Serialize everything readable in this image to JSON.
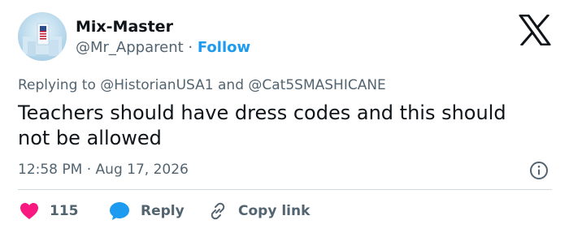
{
  "user": {
    "display_name": "Mix-Master",
    "handle": "@Mr_Apparent",
    "separator": " · ",
    "follow_label": "Follow"
  },
  "reply_context": {
    "prefix": "Replying to ",
    "mention_1": "@HistorianUSA1",
    "joiner": " and ",
    "mention_2": "@Cat5SMASHICANE"
  },
  "tweet": {
    "line_1": "Teachers should have dress codes and this should",
    "line_2": "not be allowed"
  },
  "meta": {
    "time": "12:58 PM",
    "separator": " · ",
    "date": "Aug 17, 2026"
  },
  "actions": {
    "like_count": "115",
    "reply_label": "Reply",
    "copy_label": "Copy link"
  },
  "colors": {
    "accent": "#1d9bf0",
    "like": "#f91880",
    "secondary_text": "#536471",
    "primary_text": "#0f1419",
    "divider": "#cfd9de"
  },
  "icons": {
    "brand": "x-logo-icon",
    "info": "info-icon",
    "like": "heart-icon",
    "reply": "speech-bubble-icon",
    "copy": "link-icon"
  }
}
